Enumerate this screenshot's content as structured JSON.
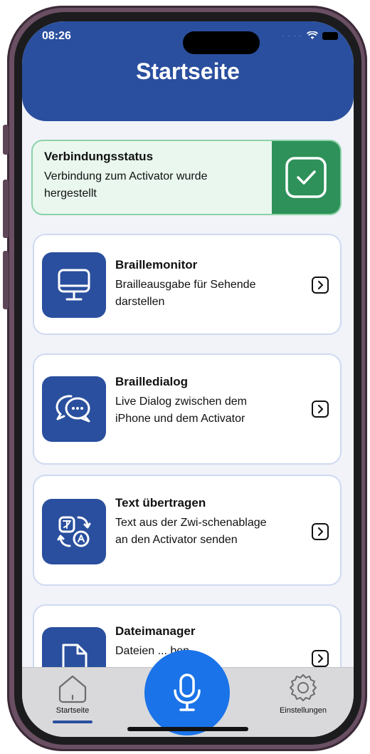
{
  "status_bar": {
    "time": "08:26"
  },
  "header": {
    "title": "Startseite"
  },
  "connection": {
    "title": "Verbindungsstatus",
    "text": "Verbindung zum Activator wurde hergestellt"
  },
  "cards": [
    {
      "title": "Braillemonitor",
      "description": "Brailleausgabe für Sehende darstellen",
      "icon": "monitor-icon"
    },
    {
      "title": "Brailledialog",
      "description": "Live Dialog zwischen dem iPhone und dem Activator",
      "icon": "chat-bubbles-icon"
    },
    {
      "title": "Text übertragen",
      "description": "Text aus der Zwi-schenablage an den Activator senden",
      "icon": "translate-icon"
    },
    {
      "title": "Dateimanager",
      "description": "Dateien ... ben",
      "icon": "file-icon"
    }
  ],
  "tabbar": {
    "home_label": "Startseite",
    "settings_label": "Einstellungen"
  },
  "colors": {
    "primary": "#2a4f9e",
    "success": "#2d9159",
    "mic": "#1a73e8"
  }
}
